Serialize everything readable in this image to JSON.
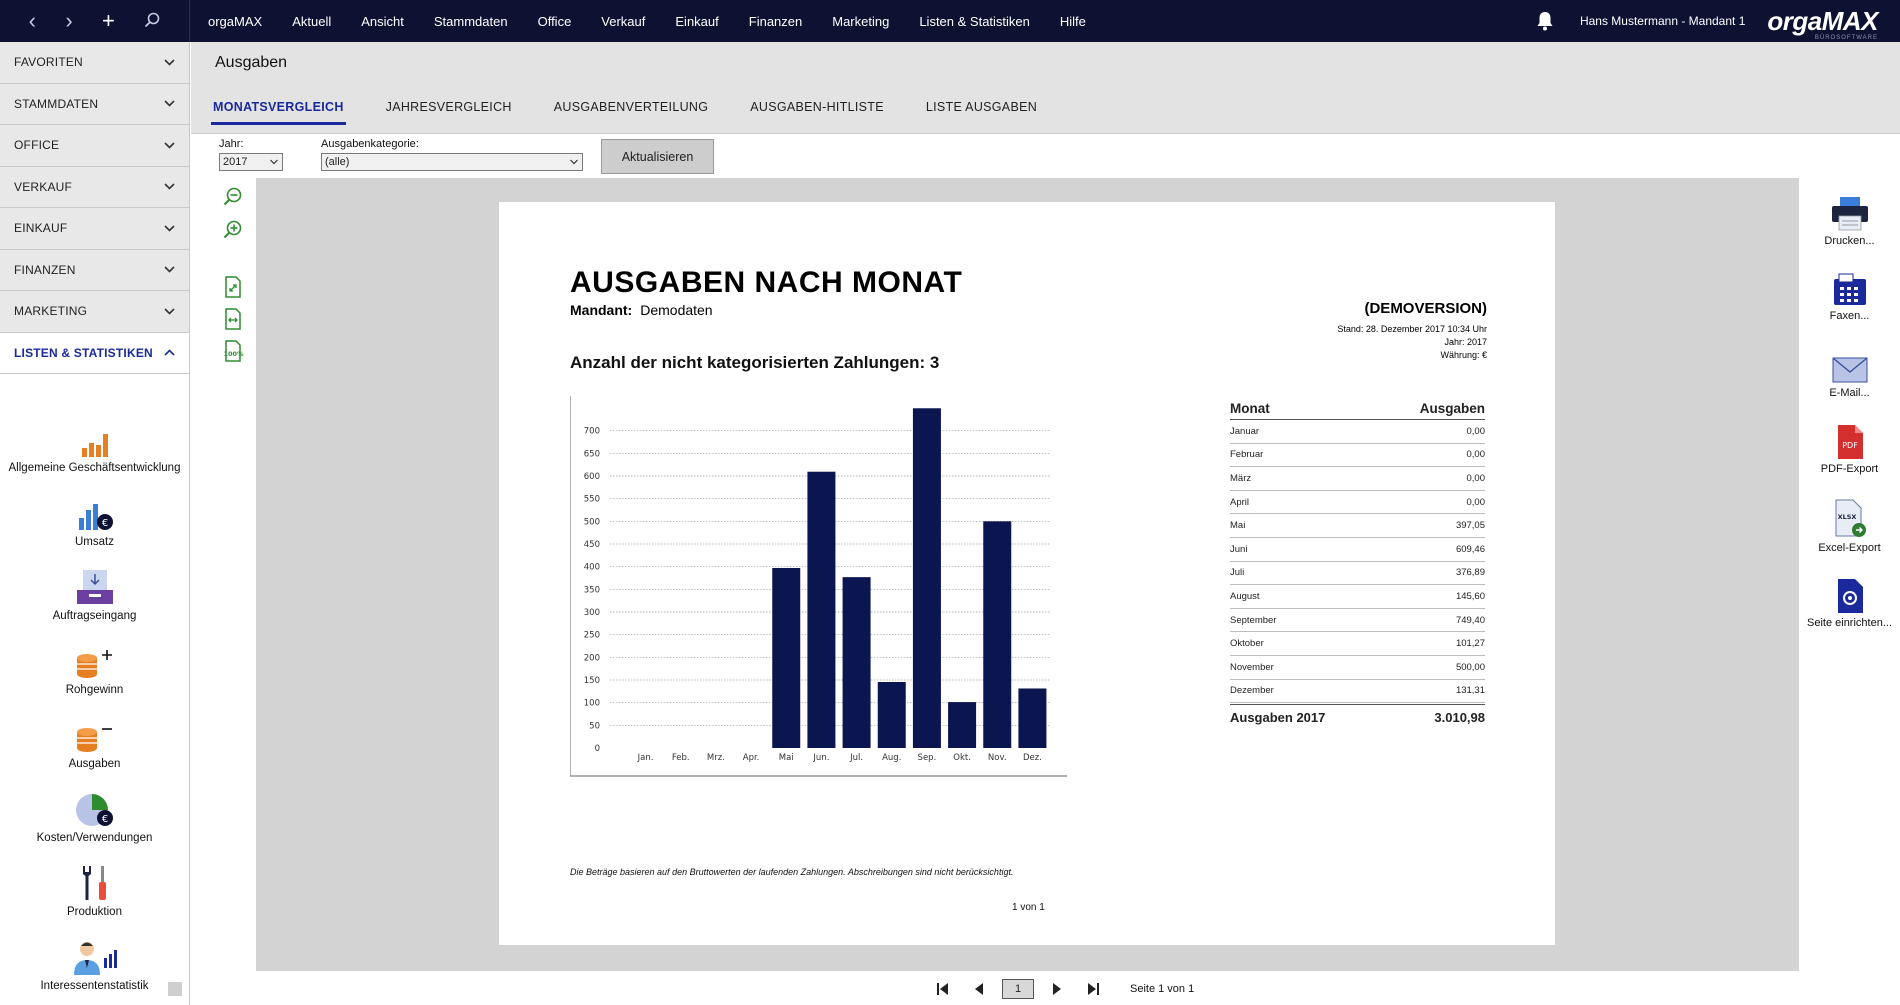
{
  "topbar": {
    "menu": [
      "orgaMAX",
      "Aktuell",
      "Ansicht",
      "Stammdaten",
      "Office",
      "Verkauf",
      "Einkauf",
      "Finanzen",
      "Marketing",
      "Listen & Statistiken",
      "Hilfe"
    ],
    "user": "Hans Mustermann - Mandant 1",
    "logo": "orgaMAX",
    "logo_tag": "BÜROSOFTWARE",
    "icons": [
      "back-icon",
      "forward-icon",
      "plus-icon",
      "search-icon",
      "bell-icon"
    ]
  },
  "sidebar": {
    "sections": [
      {
        "label": "FAVORITEN",
        "expanded": false
      },
      {
        "label": "STAMMDATEN",
        "expanded": false
      },
      {
        "label": "OFFICE",
        "expanded": false
      },
      {
        "label": "VERKAUF",
        "expanded": false
      },
      {
        "label": "EINKAUF",
        "expanded": false
      },
      {
        "label": "FINANZEN",
        "expanded": false
      },
      {
        "label": "MARKETING",
        "expanded": false
      },
      {
        "label": "LISTEN & STATISTIKEN",
        "expanded": true
      }
    ],
    "items": [
      {
        "label": "Allgemeine Geschäftsentwicklung",
        "icon": "bar-chart-icon"
      },
      {
        "label": "Umsatz",
        "icon": "revenue-chart-icon"
      },
      {
        "label": "Auftragseingang",
        "icon": "inbox-icon"
      },
      {
        "label": "Rohgewinn",
        "icon": "coins-plus-icon"
      },
      {
        "label": "Ausgaben",
        "icon": "coins-minus-icon"
      },
      {
        "label": "Kosten/Verwendungen",
        "icon": "pie-chart-icon"
      },
      {
        "label": "Produktion",
        "icon": "tools-icon"
      },
      {
        "label": "Interessentenstatistik",
        "icon": "person-chart-icon"
      }
    ]
  },
  "header": {
    "title": "Ausgaben",
    "tabs": [
      {
        "label": "MONATSVERGLEICH",
        "active": true
      },
      {
        "label": "JAHRESVERGLEICH",
        "active": false
      },
      {
        "label": "AUSGABENVERTEILUNG",
        "active": false
      },
      {
        "label": "AUSGABEN-HITLISTE",
        "active": false
      },
      {
        "label": "LISTE AUSGABEN",
        "active": false
      }
    ]
  },
  "controls": {
    "year_label": "Jahr:",
    "year_value": "2017",
    "category_label": "Ausgabenkategorie:",
    "category_value": "(alle)",
    "update_button": "Aktualisieren"
  },
  "report": {
    "title": "AUSGABEN NACH MONAT",
    "mandant_label": "Mandant:",
    "mandant_value": "Demodaten",
    "demo": "(DEMOVERSION)",
    "stand": "Stand:  28. Dezember 2017 10:34 Uhr",
    "jahr": "Jahr: 2017",
    "waehrung": "Währung: €",
    "uncategorized": "Anzahl der nicht kategorisierten Zahlungen: 3",
    "note": "Die Beträge basieren auf den Bruttowerten der laufenden Zahlungen. Abschreibungen sind nicht berücksichtigt.",
    "page": "1 von 1",
    "table_head": {
      "month": "Monat",
      "amount": "Ausgaben"
    },
    "rows": [
      {
        "month": "Januar",
        "amount": "0,00"
      },
      {
        "month": "Februar",
        "amount": "0,00"
      },
      {
        "month": "März",
        "amount": "0,00"
      },
      {
        "month": "April",
        "amount": "0,00"
      },
      {
        "month": "Mai",
        "amount": "397,05"
      },
      {
        "month": "Juni",
        "amount": "609,46"
      },
      {
        "month": "Juli",
        "amount": "376,89"
      },
      {
        "month": "August",
        "amount": "145,60"
      },
      {
        "month": "September",
        "amount": "749,40"
      },
      {
        "month": "Oktober",
        "amount": "101,27"
      },
      {
        "month": "November",
        "amount": "500,00"
      },
      {
        "month": "Dezember",
        "amount": "131,31"
      }
    ],
    "total_label": "Ausgaben 2017",
    "total_value": "3.010,98"
  },
  "chart_data": {
    "type": "bar",
    "categories": [
      "Jan.",
      "Feb.",
      "Mrz.",
      "Apr.",
      "Mai",
      "Jun.",
      "Jul.",
      "Aug.",
      "Sep.",
      "Okt.",
      "Nov.",
      "Dez."
    ],
    "values": [
      0,
      0,
      0,
      0,
      397.05,
      609.46,
      376.89,
      145.6,
      749.4,
      101.27,
      500.0,
      131.31
    ],
    "yticks": [
      0,
      50,
      100,
      150,
      200,
      250,
      300,
      350,
      400,
      450,
      500,
      550,
      600,
      650,
      700
    ],
    "ylim": [
      0,
      750
    ],
    "grid": true,
    "bar_color": "#0b1550"
  },
  "right_panel": [
    {
      "label": "Drucken...",
      "icon": "printer-icon"
    },
    {
      "label": "Faxen...",
      "icon": "fax-icon"
    },
    {
      "label": "E-Mail...",
      "icon": "mail-icon"
    },
    {
      "label": "PDF-Export",
      "icon": "pdf-icon"
    },
    {
      "label": "Excel-Export",
      "icon": "excel-icon"
    },
    {
      "label": "Seite einrichten...",
      "icon": "page-setup-icon"
    }
  ],
  "pager": {
    "current": "1",
    "info": "Seite 1 von 1"
  },
  "colors": {
    "topbar": "#0d1233",
    "accent": "#1a2a9c",
    "bar": "#0b1550",
    "tool_green": "#2e8b2e"
  }
}
